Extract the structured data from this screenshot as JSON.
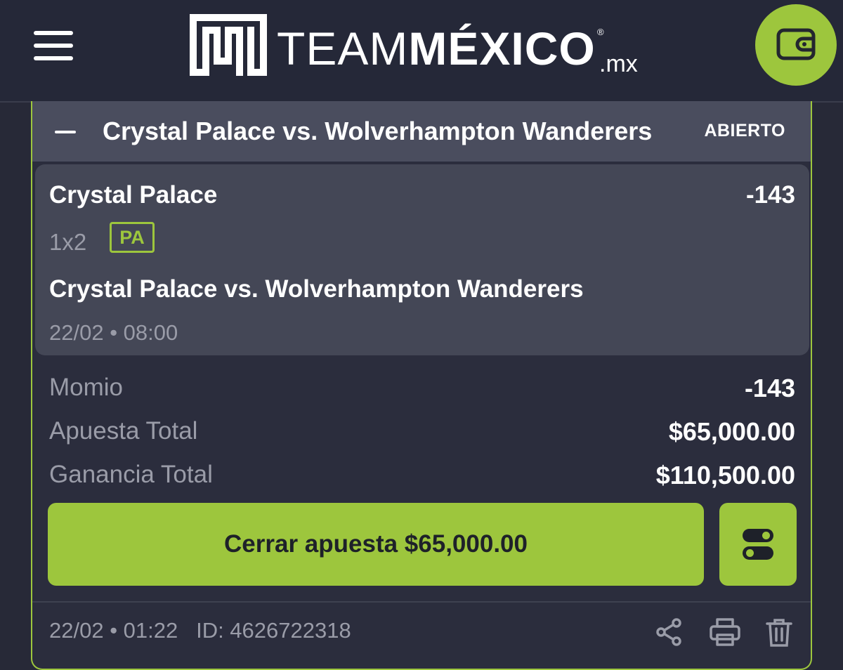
{
  "header": {
    "logo_word_light": "TEAM",
    "logo_word_bold": "MÉXICO",
    "logo_registered": "®",
    "logo_tld": ".mx",
    "menu_icon": "hamburger-menu-icon",
    "wallet_icon": "wallet-icon"
  },
  "bet": {
    "title": "Crystal Palace vs. Wolverhampton Wanderers",
    "status": "ABIERTO",
    "selection": {
      "name": "Crystal Palace",
      "odds": "-143",
      "market": "1x2",
      "badge": "PA",
      "event": "Crystal Palace vs.  Wolverhampton Wanderers",
      "event_time": "22/02 • 08:00"
    },
    "summary": [
      {
        "label": "Momio",
        "value": "-143"
      },
      {
        "label": "Apuesta Total",
        "value": "$65,000.00"
      },
      {
        "label": "Ganancia Total",
        "value": "$110,500.00"
      }
    ],
    "close_button_label": "Cerrar apuesta $65,000.00",
    "footer": {
      "placed_at": "22/02 • 01:22",
      "id_text": "ID: 4626722318"
    }
  },
  "colors": {
    "accent": "#9dc63d",
    "background": "#272937",
    "header_bar": "#4a4d5e",
    "selection_bg": "#444756",
    "muted_text": "#9a9ca8"
  },
  "icons": [
    "hamburger-menu-icon",
    "wallet-icon",
    "collapse-icon",
    "toggle-icon",
    "share-icon",
    "print-icon",
    "trash-icon"
  ]
}
